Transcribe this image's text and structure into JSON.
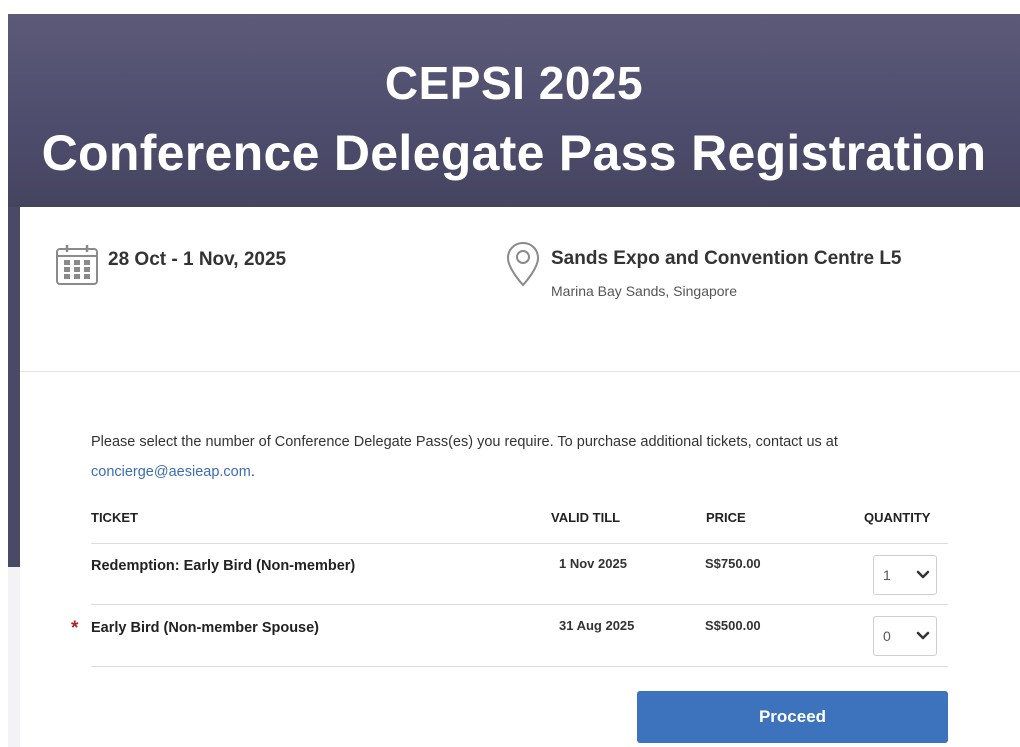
{
  "header": {
    "line1": "CEPSI 2025",
    "line2": "Conference Delegate Pass Registration"
  },
  "event": {
    "date": "28 Oct - 1 Nov, 2025",
    "venue_name": "Sands Expo and Convention Centre L5",
    "venue_location": "Marina Bay Sands, Singapore",
    "calendar_icon": "calendar-icon",
    "location_icon": "map-pin-icon"
  },
  "intro": {
    "text": "Please select the number of Conference Delegate Pass(es) you require. To purchase additional tickets, contact us at",
    "email": "concierge@aesieap.com",
    "end": "."
  },
  "table": {
    "headers": {
      "ticket": "TICKET",
      "valid_till": "VALID TILL",
      "price": "PRICE",
      "quantity": "QUANTITY"
    },
    "rows": [
      {
        "name": "Redemption: Early Bird (Non-member)",
        "valid_till": "1 Nov 2025",
        "price": "S$750.00",
        "quantity": "1",
        "required": ""
      },
      {
        "name": "Early Bird (Non-member Spouse)",
        "valid_till": "31 Aug 2025",
        "price": "S$500.00",
        "quantity": "0",
        "required": "*"
      }
    ]
  },
  "actions": {
    "proceed_label": "Proceed"
  },
  "colors": {
    "header_bg": "#55536f",
    "accent_button": "#3d73bd",
    "link": "#3a6db5",
    "required": "#b22222"
  }
}
